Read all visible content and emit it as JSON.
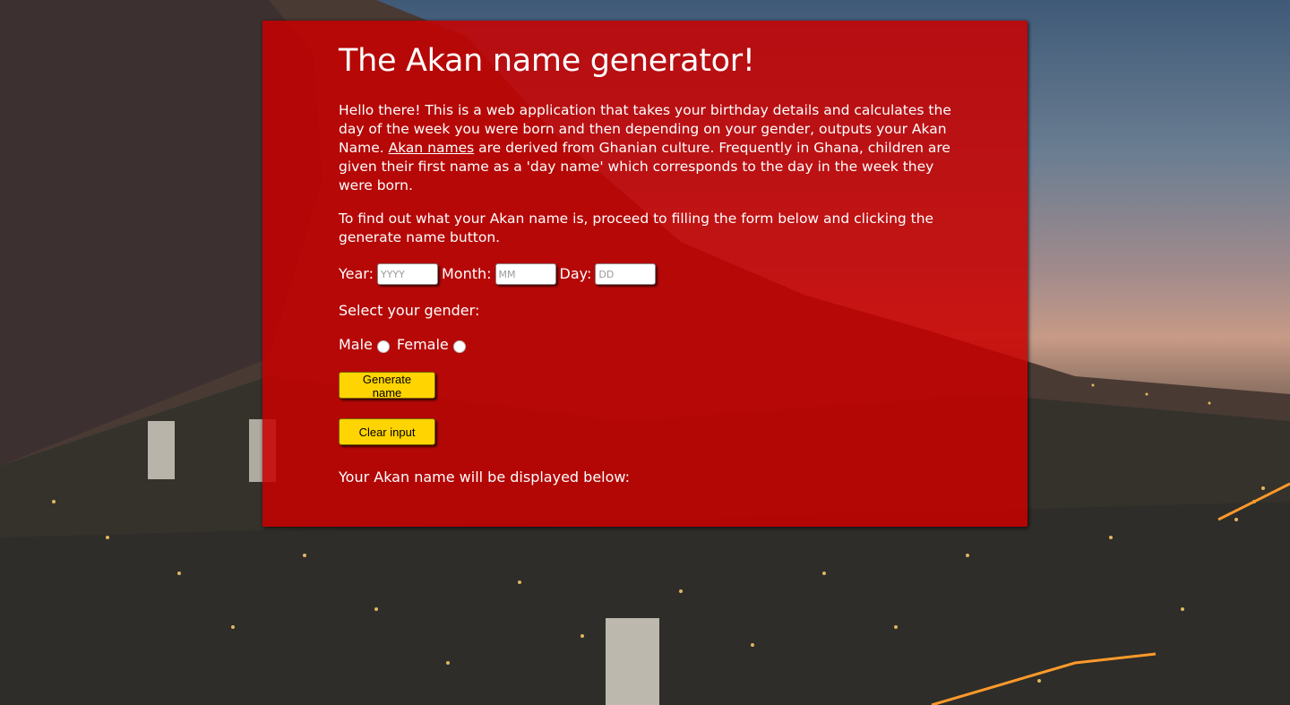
{
  "page": {
    "title": "The Akan name generator!",
    "intro_part1": "Hello there! This is a web application that takes your birthday details and calculates the day of the week you were born and then depending on your gender, outputs your Akan Name. ",
    "intro_link": "Akan names",
    "intro_part2": " are derived from Ghanian culture. Frequently in Ghana, children are given their first name as a 'day name' which corresponds to the day in the week they were born.",
    "instructions": "To find out what your Akan name is, proceed to filling the form below and clicking the generate name button."
  },
  "form": {
    "year_label": "Year:",
    "year_placeholder": "YYYY",
    "month_label": "Month:",
    "month_placeholder": "MM",
    "day_label": "Day:",
    "day_placeholder": "DD",
    "gender_prompt": "Select your gender:",
    "male_label": "Male",
    "female_label": "Female",
    "generate_button": "Generate name",
    "clear_button": "Clear input",
    "result_label": "Your Akan name will be displayed below:"
  },
  "colors": {
    "panel": "#c80000",
    "button": "#ffd400"
  }
}
